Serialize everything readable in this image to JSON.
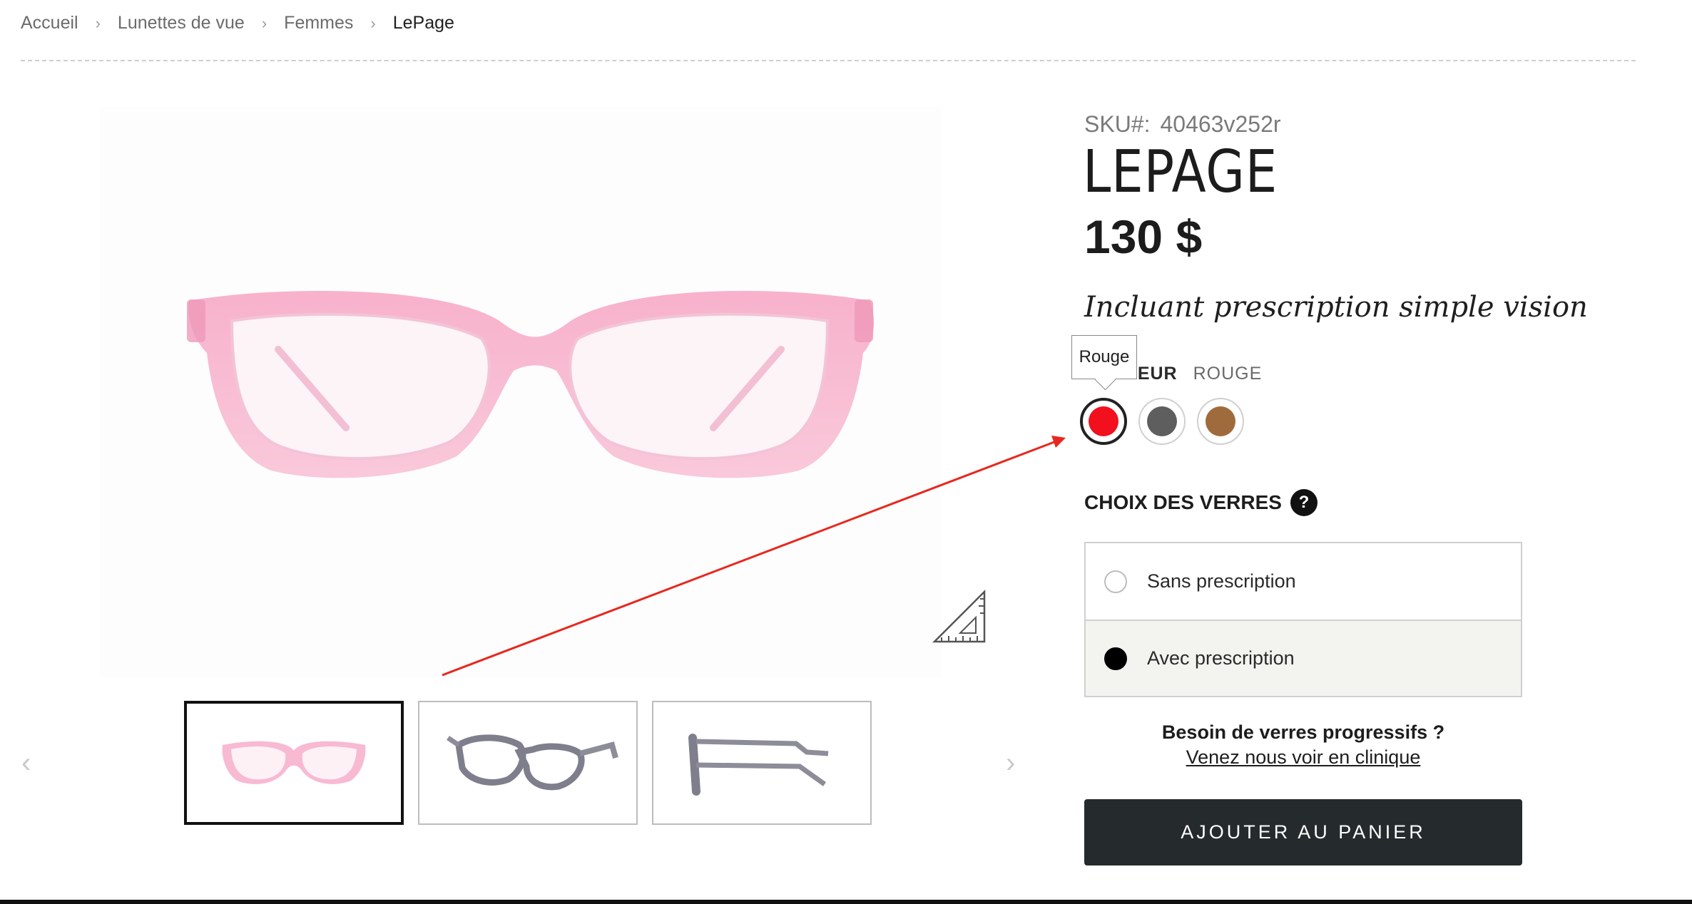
{
  "breadcrumb": {
    "items": [
      "Accueil",
      "Lunettes de vue",
      "Femmes",
      "LePage"
    ],
    "separator": "›"
  },
  "gallery": {
    "main_image_alt": "pink eyeglasses front view",
    "thumbnails": [
      "front view",
      "angled view",
      "side view"
    ],
    "prev_label": "‹",
    "next_label": "›"
  },
  "product": {
    "sku_label": "SKU#:",
    "sku_value": "40463v252r",
    "title": "LEPAGE",
    "price": "130 $",
    "tagline": "Incluant prescription simple vision"
  },
  "color": {
    "tooltip": "Rouge",
    "label": "COULEUR",
    "value": "ROUGE",
    "swatches": [
      {
        "name": "Rouge",
        "hex": "#f2101e"
      },
      {
        "name": "Gris",
        "hex": "#5e5e5e"
      },
      {
        "name": "Brun",
        "hex": "#a06b3c"
      }
    ]
  },
  "lenses": {
    "heading": "CHOIX DES VERRES",
    "help": "?",
    "options": [
      {
        "label": "Sans prescription",
        "selected": false
      },
      {
        "label": "Avec prescription",
        "selected": true
      }
    ]
  },
  "progressive": {
    "question": "Besoin de verres progressifs ?",
    "link": "Venez nous voir en clinique"
  },
  "cart": {
    "button_label": "AJOUTER AU PANIER"
  },
  "colors": {
    "annotation_arrow": "#e8281e",
    "button_bg": "#252a2d",
    "frame_pink": "#f7b6cf"
  }
}
